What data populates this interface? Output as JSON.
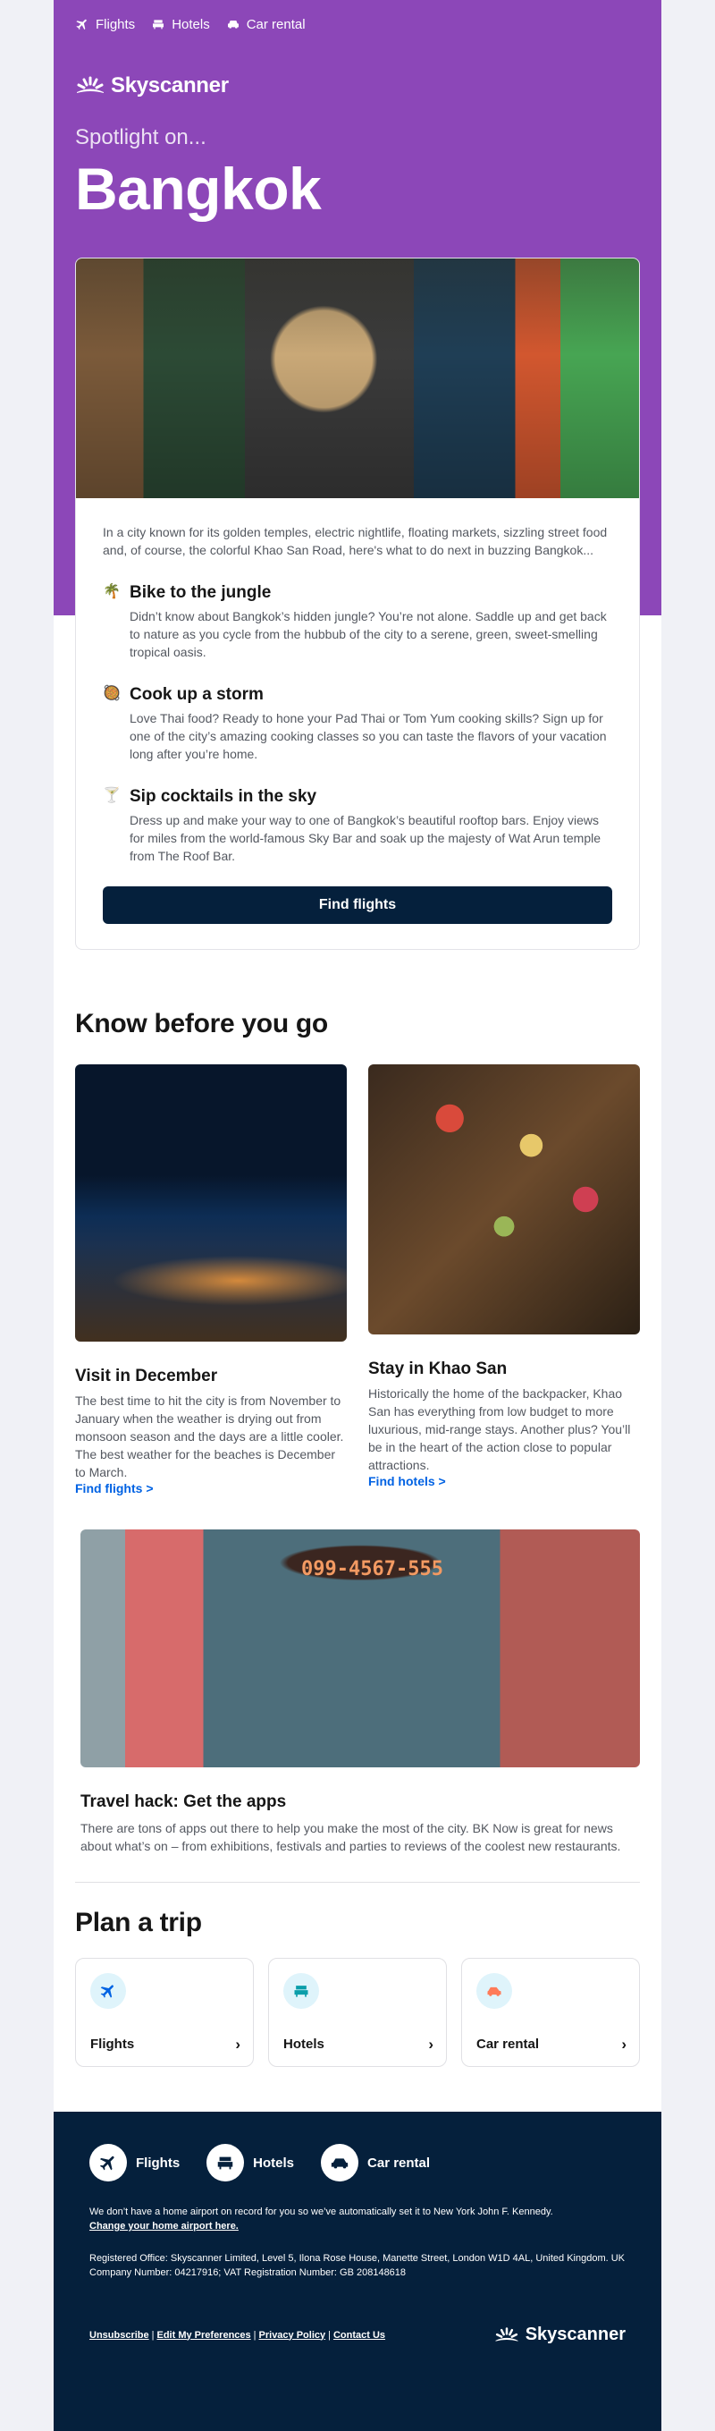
{
  "topnav": [
    {
      "label": "Flights",
      "icon": "plane-icon"
    },
    {
      "label": "Hotels",
      "icon": "bed-icon"
    },
    {
      "label": "Car rental",
      "icon": "car-icon"
    }
  ],
  "brand": {
    "name": "Skyscanner",
    "primary_color": "#8c47b8",
    "dark_color": "#05203c",
    "link_color": "#0062e3"
  },
  "hero": {
    "kicker": "Spotlight on...",
    "city": "Bangkok",
    "image_alt": "Floating market vendor in straw hat"
  },
  "intro": {
    "text": "In a city known for its golden temples, electric nightlife, floating markets, sizzling street food and, of course, the colorful Khao San Road, here's what to do next in buzzing Bangkok...",
    "tips": [
      {
        "icon": "🌴",
        "icon_name": "palm-tree-icon",
        "title": "Bike to the jungle",
        "desc": "Didn’t know about Bangkok’s hidden jungle? You’re not alone. Saddle up and get back to nature as you cycle from the hubbub of the city to a serene, green, sweet-smelling tropical oasis."
      },
      {
        "icon": "🥘",
        "icon_name": "food-pan-icon",
        "title": "Cook up a storm",
        "desc": "Love Thai food? Ready to hone your Pad Thai or Tom Yum cooking skills? Sign up for one of the city’s amazing cooking classes so you can taste the flavors of your vacation long after you’re home."
      },
      {
        "icon": "🍸",
        "icon_name": "cocktail-icon",
        "title": "Sip cocktails in the sky",
        "desc": "Dress up and make your way to one of Bangkok’s beautiful rooftop bars. Enjoy views for miles from the world-famous Sky Bar and soak up the majesty of Wat Arun temple from The Roof Bar."
      }
    ],
    "cta_label": "Find flights"
  },
  "kbyg": {
    "title": "Know before you go",
    "cards": [
      {
        "title": "Visit in December",
        "text": "The best time to hit the city is from November to January when the weather is drying out from monsoon season and the days are a little cooler. The best weather for the beaches is December to March.",
        "link": "Find flights >"
      },
      {
        "title": "Stay in Khao San",
        "text": "Historically the home of the backpacker, Khao San has everything from low budget to more luxurious, mid-range stays. Another plus? You’ll be in the heart of the action close to popular attractions.",
        "link": "Find hotels >"
      }
    ],
    "hack": {
      "image_text": "099-4567-555",
      "title": "Travel hack: Get the apps",
      "text": "There are tons of apps out there to help you make the most of the city. BK Now is great for news about what’s on – from exhibitions, festivals and parties to reviews of the coolest new restaurants."
    }
  },
  "plan": {
    "title": "Plan a trip",
    "cards": [
      {
        "label": "Flights",
        "icon": "plane-icon",
        "color": "#0062e3"
      },
      {
        "label": "Hotels",
        "icon": "bed-icon",
        "color": "#0b9eaa"
      },
      {
        "label": "Car rental",
        "icon": "car-icon",
        "color": "#ff7b59"
      }
    ],
    "chevron": "›"
  },
  "footer": {
    "nav": [
      {
        "label": "Flights",
        "icon": "plane-icon"
      },
      {
        "label": "Hotels",
        "icon": "bed-icon"
      },
      {
        "label": "Car rental",
        "icon": "car-icon"
      }
    ],
    "airport_note": "We don’t have a home airport on record for you so we’ve automatically set it to New York John F. Kennedy.",
    "airport_link": "Change your home airport here.",
    "registered": "Registered Office: Skyscanner Limited, Level 5, Ilona Rose House, Manette Street, London W1D 4AL, United Kingdom. UK Company Number: 04217916; VAT Registration Number: GB 208148618",
    "links": [
      "Unsubscribe",
      "Edit My Preferences",
      "Privacy Policy",
      "Contact Us"
    ],
    "separator": "|"
  }
}
